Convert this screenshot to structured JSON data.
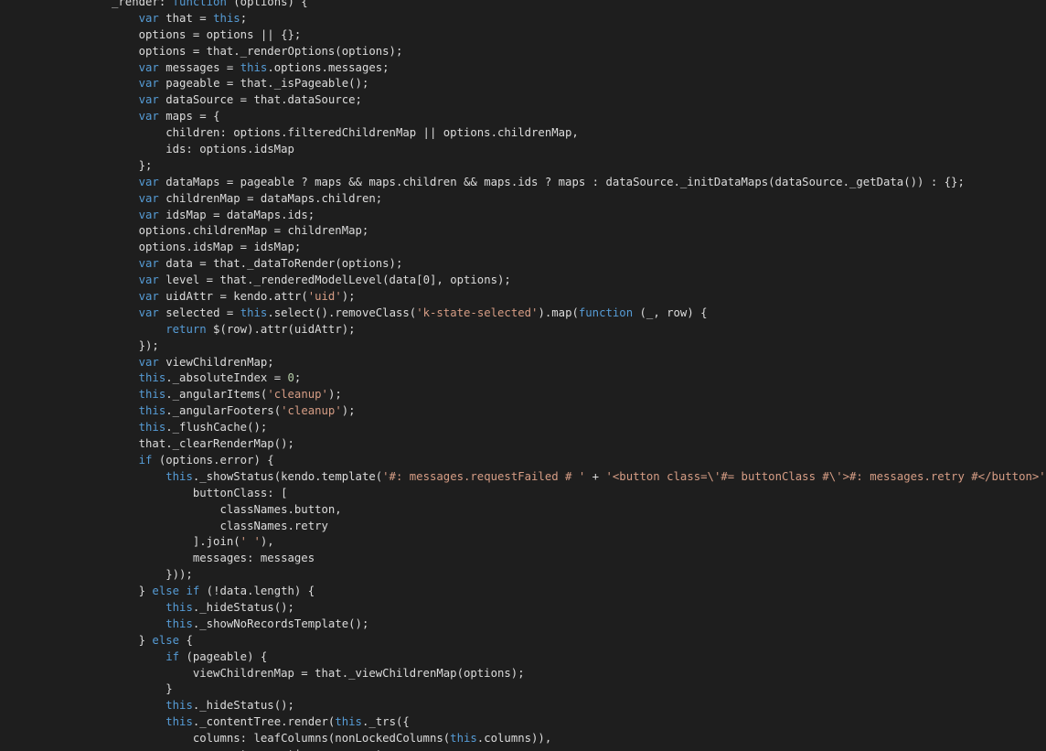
{
  "colors": {
    "background": "#1e1e1e",
    "plain": "#dcdcdc",
    "keyword": "#569cd6",
    "string": "#d69d85",
    "number": "#b5cea8"
  },
  "code_lines": [
    [
      [
        "t",
        "_render: "
      ],
      [
        "k",
        "function"
      ],
      [
        "t",
        " (options) {"
      ]
    ],
    [
      [
        "t",
        "    "
      ],
      [
        "k",
        "var"
      ],
      [
        "t",
        " that = "
      ],
      [
        "k",
        "this"
      ],
      [
        "t",
        ";"
      ]
    ],
    [
      [
        "t",
        "    options = options || {};"
      ]
    ],
    [
      [
        "t",
        "    options = that._renderOptions(options);"
      ]
    ],
    [
      [
        "t",
        "    "
      ],
      [
        "k",
        "var"
      ],
      [
        "t",
        " messages = "
      ],
      [
        "k",
        "this"
      ],
      [
        "t",
        ".options.messages;"
      ]
    ],
    [
      [
        "t",
        "    "
      ],
      [
        "k",
        "var"
      ],
      [
        "t",
        " pageable = that._isPageable();"
      ]
    ],
    [
      [
        "t",
        "    "
      ],
      [
        "k",
        "var"
      ],
      [
        "t",
        " dataSource = that.dataSource;"
      ]
    ],
    [
      [
        "t",
        "    "
      ],
      [
        "k",
        "var"
      ],
      [
        "t",
        " maps = {"
      ]
    ],
    [
      [
        "t",
        "        children: options.filteredChildrenMap || options.childrenMap,"
      ]
    ],
    [
      [
        "t",
        "        ids: options.idsMap"
      ]
    ],
    [
      [
        "t",
        "    };"
      ]
    ],
    [
      [
        "t",
        "    "
      ],
      [
        "k",
        "var"
      ],
      [
        "t",
        " dataMaps = pageable ? maps && maps.children && maps.ids ? maps : dataSource._initDataMaps(dataSource._getData()) : {};"
      ]
    ],
    [
      [
        "t",
        "    "
      ],
      [
        "k",
        "var"
      ],
      [
        "t",
        " childrenMap = dataMaps.children;"
      ]
    ],
    [
      [
        "t",
        "    "
      ],
      [
        "k",
        "var"
      ],
      [
        "t",
        " idsMap = dataMaps.ids;"
      ]
    ],
    [
      [
        "t",
        "    options.childrenMap = childrenMap;"
      ]
    ],
    [
      [
        "t",
        "    options.idsMap = idsMap;"
      ]
    ],
    [
      [
        "t",
        "    "
      ],
      [
        "k",
        "var"
      ],
      [
        "t",
        " data = that._dataToRender(options);"
      ]
    ],
    [
      [
        "t",
        "    "
      ],
      [
        "k",
        "var"
      ],
      [
        "t",
        " level = that._renderedModelLevel(data[0], options);"
      ]
    ],
    [
      [
        "t",
        "    "
      ],
      [
        "k",
        "var"
      ],
      [
        "t",
        " uidAttr = kendo.attr("
      ],
      [
        "s",
        "'uid'"
      ],
      [
        "t",
        ");"
      ]
    ],
    [
      [
        "t",
        "    "
      ],
      [
        "k",
        "var"
      ],
      [
        "t",
        " selected = "
      ],
      [
        "k",
        "this"
      ],
      [
        "t",
        ".select().removeClass("
      ],
      [
        "s",
        "'k-state-selected'"
      ],
      [
        "t",
        ").map("
      ],
      [
        "k",
        "function"
      ],
      [
        "t",
        " (_, row) {"
      ]
    ],
    [
      [
        "t",
        "        "
      ],
      [
        "k",
        "return"
      ],
      [
        "t",
        " $(row).attr(uidAttr);"
      ]
    ],
    [
      [
        "t",
        "    });"
      ]
    ],
    [
      [
        "t",
        "    "
      ],
      [
        "k",
        "var"
      ],
      [
        "t",
        " viewChildrenMap;"
      ]
    ],
    [
      [
        "t",
        "    "
      ],
      [
        "k",
        "this"
      ],
      [
        "t",
        "._absoluteIndex = "
      ],
      [
        "n",
        "0"
      ],
      [
        "t",
        ";"
      ]
    ],
    [
      [
        "t",
        "    "
      ],
      [
        "k",
        "this"
      ],
      [
        "t",
        "._angularItems("
      ],
      [
        "s",
        "'cleanup'"
      ],
      [
        "t",
        ");"
      ]
    ],
    [
      [
        "t",
        "    "
      ],
      [
        "k",
        "this"
      ],
      [
        "t",
        "._angularFooters("
      ],
      [
        "s",
        "'cleanup'"
      ],
      [
        "t",
        ");"
      ]
    ],
    [
      [
        "t",
        "    "
      ],
      [
        "k",
        "this"
      ],
      [
        "t",
        "._flushCache();"
      ]
    ],
    [
      [
        "t",
        "    that._clearRenderMap();"
      ]
    ],
    [
      [
        "t",
        "    "
      ],
      [
        "k",
        "if"
      ],
      [
        "t",
        " (options.error) {"
      ]
    ],
    [
      [
        "t",
        "        "
      ],
      [
        "k",
        "this"
      ],
      [
        "t",
        "._showStatus(kendo.template("
      ],
      [
        "s",
        "'#: messages.requestFailed # '"
      ],
      [
        "t",
        " + "
      ],
      [
        "s",
        "'<button class=\\'#= buttonClass #\\'>#: messages.retry #</button>'"
      ],
      [
        "t",
        ")({"
      ]
    ],
    [
      [
        "t",
        "            buttonClass: ["
      ]
    ],
    [
      [
        "t",
        "                classNames.button,"
      ]
    ],
    [
      [
        "t",
        "                classNames.retry"
      ]
    ],
    [
      [
        "t",
        "            ].join("
      ],
      [
        "s",
        "' '"
      ],
      [
        "t",
        "),"
      ]
    ],
    [
      [
        "t",
        "            messages: messages"
      ]
    ],
    [
      [
        "t",
        "        }));"
      ]
    ],
    [
      [
        "t",
        "    } "
      ],
      [
        "k",
        "else"
      ],
      [
        "t",
        " "
      ],
      [
        "k",
        "if"
      ],
      [
        "t",
        " (!data.length) {"
      ]
    ],
    [
      [
        "t",
        "        "
      ],
      [
        "k",
        "this"
      ],
      [
        "t",
        "._hideStatus();"
      ]
    ],
    [
      [
        "t",
        "        "
      ],
      [
        "k",
        "this"
      ],
      [
        "t",
        "._showNoRecordsTemplate();"
      ]
    ],
    [
      [
        "t",
        "    } "
      ],
      [
        "k",
        "else"
      ],
      [
        "t",
        " {"
      ]
    ],
    [
      [
        "t",
        "        "
      ],
      [
        "k",
        "if"
      ],
      [
        "t",
        " (pageable) {"
      ]
    ],
    [
      [
        "t",
        "            viewChildrenMap = that._viewChildrenMap(options);"
      ]
    ],
    [
      [
        "t",
        "        }"
      ]
    ],
    [
      [
        "t",
        "        "
      ],
      [
        "k",
        "this"
      ],
      [
        "t",
        "._hideStatus();"
      ]
    ],
    [
      [
        "t",
        "        "
      ],
      [
        "k",
        "this"
      ],
      [
        "t",
        "._contentTree.render("
      ],
      [
        "k",
        "this"
      ],
      [
        "t",
        "._trs({"
      ]
    ],
    [
      [
        "t",
        "            columns: leafColumns(nonLockedColumns("
      ],
      [
        "k",
        "this"
      ],
      [
        "t",
        ".columns)),"
      ]
    ],
    [
      [
        "t",
        "            aggregates: options.aggregates,"
      ]
    ]
  ]
}
